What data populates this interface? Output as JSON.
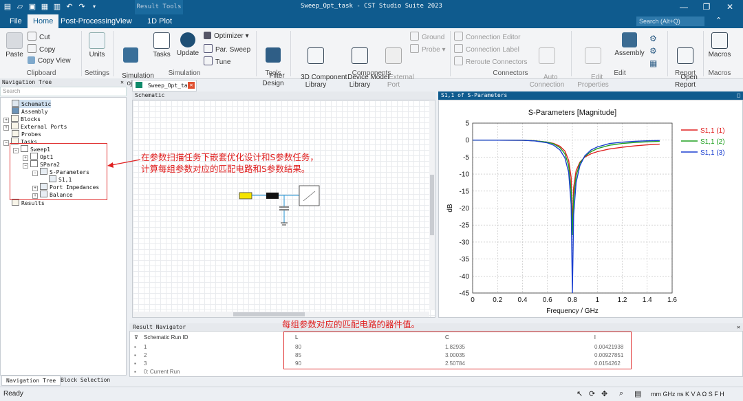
{
  "window": {
    "title": "Sweep_Opt_task - CST Studio Suite 2023",
    "context_tab": "Result Tools"
  },
  "menu": {
    "tabs": [
      "File",
      "Home",
      "Post-Processing",
      "View",
      "1D Plot"
    ],
    "search_placeholder": "Search (Alt+Q)"
  },
  "ribbon": {
    "clipboard": {
      "paste": "Paste",
      "cut": "Cut",
      "copy": "Copy",
      "copy_view": "Copy View",
      "group": "Clipboard"
    },
    "settings": {
      "units": "Units",
      "group": "Settings"
    },
    "simulation": {
      "sim_project": "Simulation\nProject",
      "tasks": "Tasks",
      "update": "Update",
      "optimizer": "Optimizer",
      "par_sweep": "Par. Sweep",
      "tune": "Tune",
      "group": "Simulation"
    },
    "tools": {
      "filter_design": "Filter\nDesign",
      "group": "Tools"
    },
    "components": {
      "c3d": "3D Component\nLibrary",
      "device_model": "Device Model\nLibrary",
      "external_port": "External\nPort",
      "ground": "Ground",
      "probe": "Probe",
      "group": "Components"
    },
    "connectors": {
      "connection_editor": "Connection Editor",
      "connection_label": "Connection Label",
      "reroute": "Reroute Connectors",
      "auto_connection": "Auto\nConnection",
      "group": "Connectors"
    },
    "edit": {
      "edit_properties": "Edit\nProperties",
      "assembly": "Assembly",
      "group": "Edit"
    },
    "report": {
      "open_report": "Open\nReport",
      "group": "Report"
    },
    "macros": {
      "macros": "Macros",
      "group": "Macros"
    }
  },
  "nav": {
    "title": "Navigation Tree",
    "search_placeholder": "Search",
    "items": [
      "Schematic",
      "Assembly",
      "Blocks",
      "External Ports",
      "Probes",
      "Tasks",
      "Sweep1",
      "Opt1",
      "SPara2",
      "S-Parameters",
      "S1,1",
      "Port Impedances",
      "Balance",
      "Results"
    ],
    "bottom_tabs": [
      "Navigation Tree",
      "Block Selection Tree"
    ]
  },
  "document_tab": "Sweep_Opt_task",
  "schematic_title": "Schematic",
  "plot_window_title": "S1,1 of S-Parameters",
  "chart_data": {
    "type": "line",
    "title": "S-Parameters [Magnitude]",
    "xlabel": "Frequency / GHz",
    "ylabel": "dB",
    "xlim": [
      0,
      1.6
    ],
    "ylim": [
      -45,
      5
    ],
    "xticks": [
      0,
      0.2,
      0.4,
      0.6,
      0.8,
      1,
      1.2,
      1.4,
      1.6
    ],
    "yticks": [
      5,
      0,
      -5,
      -10,
      -15,
      -20,
      -25,
      -30,
      -35,
      -40,
      -45
    ],
    "grid": true,
    "legend_position": "top-right",
    "series": [
      {
        "name": "S1,1 (1)",
        "color": "#e02020",
        "x": [
          0,
          0.4,
          0.5,
          0.6,
          0.65,
          0.7,
          0.74,
          0.77,
          0.79,
          0.8,
          0.81,
          0.83,
          0.86,
          0.9,
          0.95,
          1.0,
          1.1,
          1.2,
          1.3,
          1.4,
          1.5
        ],
        "y": [
          0,
          -0.05,
          -0.2,
          -0.6,
          -1.0,
          -1.8,
          -3.2,
          -6.0,
          -11.0,
          -25.0,
          -14.0,
          -9.0,
          -6.5,
          -5.0,
          -4.0,
          -3.4,
          -2.6,
          -2.1,
          -1.7,
          -1.4,
          -1.2
        ]
      },
      {
        "name": "S1,1 (2)",
        "color": "#20a020",
        "x": [
          0,
          0.4,
          0.5,
          0.6,
          0.65,
          0.7,
          0.74,
          0.77,
          0.79,
          0.8,
          0.81,
          0.83,
          0.86,
          0.9,
          0.95,
          1.0,
          1.1,
          1.2,
          1.3,
          1.4,
          1.5
        ],
        "y": [
          0,
          -0.05,
          -0.2,
          -0.6,
          -1.1,
          -2.2,
          -4.0,
          -7.5,
          -15.0,
          -28.0,
          -17.0,
          -10.5,
          -6.8,
          -4.8,
          -3.4,
          -2.5,
          -1.5,
          -1.0,
          -0.7,
          -0.5,
          -0.35
        ]
      },
      {
        "name": "S1,1 (3)",
        "color": "#1a3fd0",
        "x": [
          0,
          0.4,
          0.5,
          0.6,
          0.65,
          0.7,
          0.74,
          0.77,
          0.79,
          0.8,
          0.81,
          0.83,
          0.86,
          0.9,
          0.95,
          1.0,
          1.1,
          1.2,
          1.3,
          1.4,
          1.5
        ],
        "y": [
          0,
          -0.05,
          -0.25,
          -0.8,
          -1.5,
          -2.9,
          -5.2,
          -9.5,
          -19.0,
          -45.0,
          -22.0,
          -12.5,
          -7.5,
          -4.6,
          -2.9,
          -2.0,
          -1.0,
          -0.6,
          -0.35,
          -0.2,
          -0.1
        ]
      }
    ]
  },
  "result_navigator": {
    "title": "Result Navigator",
    "columns": [
      "Schematic Run ID",
      "L",
      "C",
      "l"
    ],
    "rows": [
      [
        "1",
        "80",
        "1.82935",
        "0.00421938"
      ],
      [
        "2",
        "85",
        "3.00035",
        "0.00927851"
      ],
      [
        "3",
        "90",
        "2.50784",
        "0.0154262"
      ],
      [
        "0: Current Run",
        "",
        "",
        ""
      ]
    ]
  },
  "status": {
    "left": "Ready",
    "units": "mm GHz ns K V A Ω S F H"
  },
  "annotations": {
    "tree_note_1": "在参数扫描任务下嵌套优化设计和S参数任务，",
    "tree_note_2": "计算每组参数对应的匹配电路和S参数结果。",
    "table_note": "每组参数对应的匹配电路的器件值。"
  },
  "colors": {
    "titlebar": "#0f5b8e",
    "annotation_red": "#e02020"
  }
}
